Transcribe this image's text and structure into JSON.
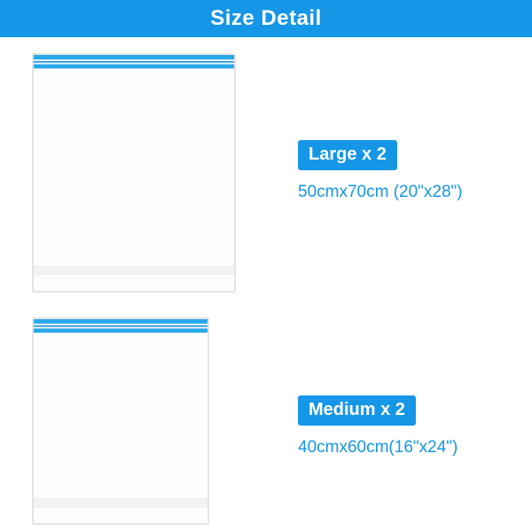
{
  "header": {
    "title": "Size Detail"
  },
  "items": [
    {
      "badge": "Large x 2",
      "dimensions": "50cmx70cm (20\"x28\")"
    },
    {
      "badge": "Medium x 2",
      "dimensions": "40cmx60cm(16\"x24\")"
    }
  ]
}
